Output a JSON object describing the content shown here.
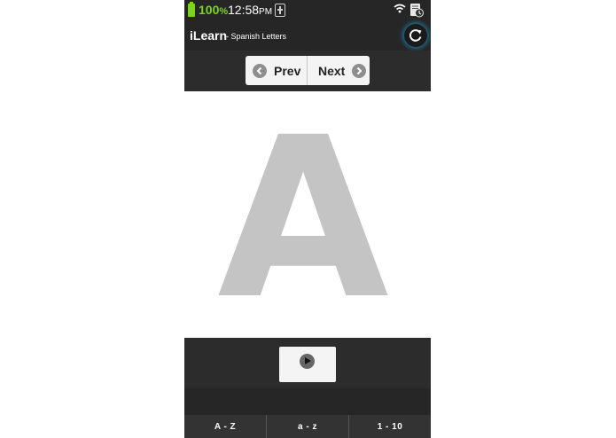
{
  "status_bar": {
    "battery_percent": "100",
    "battery_unit": "%",
    "time": "12:58",
    "ampm": "PM",
    "battery_color": "#7ed321",
    "icons": [
      "battery-icon",
      "usb-icon",
      "wifi-icon",
      "notification-icon"
    ]
  },
  "app": {
    "title": "iLearn",
    "subtitle": "- Spanish Letters",
    "refresh_icon": "refresh-icon",
    "accent_glow": "#1f6d8f"
  },
  "nav": {
    "prev_label": "Prev",
    "next_label": "Next",
    "prev_icon": "chevron-left-icon",
    "next_icon": "chevron-right-icon"
  },
  "card": {
    "letter": "A",
    "letter_color": "#c4c4c4"
  },
  "player": {
    "play_icon": "play-icon"
  },
  "tabs": [
    {
      "label": "A - Z"
    },
    {
      "label": "a - z"
    },
    {
      "label": "1 - 10"
    }
  ]
}
